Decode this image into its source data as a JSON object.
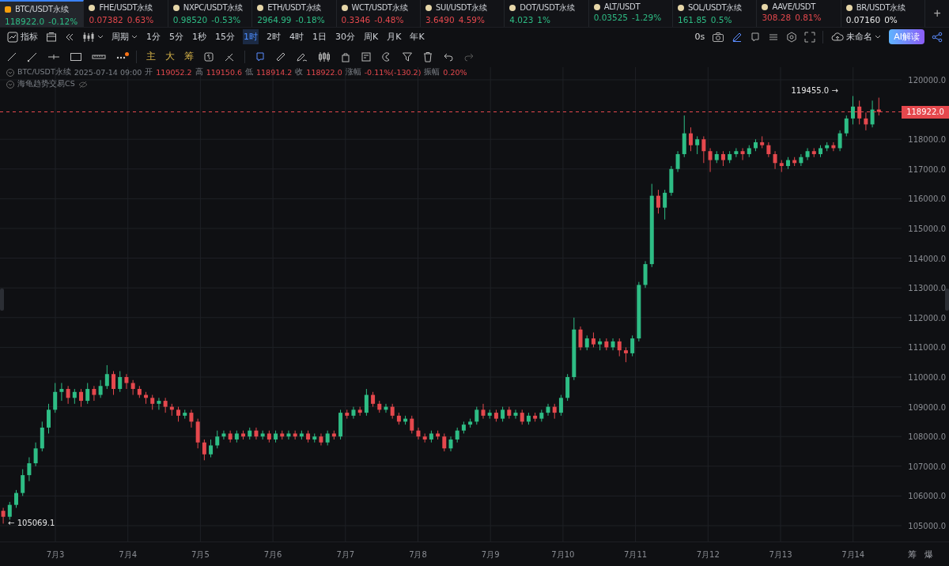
{
  "tickers": [
    {
      "symbol": "BTC/USDT永续",
      "price": "118922.0",
      "change": "-0.12%",
      "color": "#2ebd85",
      "selected": true
    },
    {
      "symbol": "FHE/USDT永续",
      "price": "0.07382",
      "change": "0.63%",
      "color": "#e5484d",
      "selected": false
    },
    {
      "symbol": "NXPC/USDT永续",
      "price": "0.98520",
      "change": "-0.53%",
      "color": "#2ebd85",
      "selected": false
    },
    {
      "symbol": "ETH/USDT永续",
      "price": "2964.99",
      "change": "-0.18%",
      "color": "#2ebd85",
      "selected": false
    },
    {
      "symbol": "WCT/USDT永续",
      "price": "0.3346",
      "change": "-0.48%",
      "color": "#e5484d",
      "selected": false
    },
    {
      "symbol": "SUI/USDT永续",
      "price": "3.6490",
      "change": "4.59%",
      "color": "#e5484d",
      "selected": false
    },
    {
      "symbol": "DOT/USDT永续",
      "price": "4.023",
      "change": "1%",
      "color": "#2ebd85",
      "selected": false
    },
    {
      "symbol": "ALT/USDT",
      "price": "0.03525",
      "change": "-1.29%",
      "color": "#2ebd85",
      "selected": false
    },
    {
      "symbol": "SOL/USDT永续",
      "price": "161.85",
      "change": "0.5%",
      "color": "#2ebd85",
      "selected": false
    },
    {
      "symbol": "AAVE/USDT",
      "price": "308.28",
      "change": "0.81%",
      "color": "#e5484d",
      "selected": false
    },
    {
      "symbol": "BR/USDT永续",
      "price": "0.07160",
      "change": "0%",
      "color": "#e8e8e8",
      "selected": false
    }
  ],
  "add_tab": "+",
  "toolbar": {
    "indicators": "指标",
    "period": "周期",
    "intervals": [
      {
        "label": "1分",
        "selected": false
      },
      {
        "label": "5分",
        "selected": false
      },
      {
        "label": "1秒",
        "selected": false
      },
      {
        "label": "15分",
        "selected": false
      },
      {
        "label": "1时",
        "selected": true
      },
      {
        "label": "2时",
        "selected": false
      },
      {
        "label": "4时",
        "selected": false
      },
      {
        "label": "1日",
        "selected": false
      },
      {
        "label": "30分",
        "selected": false
      },
      {
        "label": "周K",
        "selected": false
      },
      {
        "label": "月K",
        "selected": false
      },
      {
        "label": "年K",
        "selected": false
      }
    ],
    "countdown": "0s",
    "layout_name": "未命名",
    "ai_button": "AI解读"
  },
  "draw_tools": {
    "text_tools": [
      "主",
      "大",
      "筹"
    ]
  },
  "info": {
    "symbol": "BTC/USDT永续",
    "time": "2025-07-14 09:00",
    "fields": [
      {
        "label": "开",
        "value": "119052.2"
      },
      {
        "label": "高",
        "value": "119150.6"
      },
      {
        "label": "低",
        "value": "118914.2"
      },
      {
        "label": "收",
        "value": "118922.0"
      },
      {
        "label": "涨幅",
        "value": "-0.11%(-130.2)"
      },
      {
        "label": "振幅",
        "value": "0.20%"
      }
    ],
    "indicator": "海龟趋势交易CS"
  },
  "chart": {
    "high_marker": "119455.0 →",
    "low_marker": "← 105069.1",
    "current_price": "118922.0",
    "x_labels": [
      "7月3",
      "7月4",
      "7月5",
      "7月6",
      "7月7",
      "7月8",
      "7月9",
      "7月10",
      "7月11",
      "7月12",
      "7月13",
      "7月14"
    ],
    "chart_data": {
      "type": "candlestick",
      "ylim": [
        104468,
        120425
      ],
      "grid": true,
      "ref_lines": [
        {
          "axis": "y",
          "value": 118922,
          "color": "#e5484d"
        }
      ],
      "yticks": [
        {
          "value": 120000,
          "label": "120000.0"
        },
        {
          "value": 118000,
          "label": "118000.0"
        },
        {
          "value": 117000,
          "label": "117000.0"
        },
        {
          "value": 116000,
          "label": "116000.0"
        },
        {
          "value": 115000,
          "label": "115000.0"
        },
        {
          "value": 114000,
          "label": "114000.0"
        },
        {
          "value": 113000,
          "label": "113000.0"
        },
        {
          "value": 112000,
          "label": "112000.0"
        },
        {
          "value": 111000,
          "label": "111000.0"
        },
        {
          "value": 110000,
          "label": "110000.0"
        },
        {
          "value": 109000,
          "label": "109000.0"
        },
        {
          "value": 108000,
          "label": "108000.0"
        },
        {
          "value": 107000,
          "label": "107000.0"
        },
        {
          "value": 106000,
          "label": "106000.0"
        },
        {
          "value": 105000,
          "label": "105000.0"
        }
      ],
      "ohlc": [
        [
          105500,
          105600,
          105069,
          105300
        ],
        [
          105300,
          105800,
          105200,
          105700
        ],
        [
          105700,
          106200,
          105600,
          106100
        ],
        [
          106100,
          106900,
          106000,
          106700
        ],
        [
          106700,
          107300,
          106500,
          107100
        ],
        [
          107100,
          107800,
          107000,
          107600
        ],
        [
          107600,
          108500,
          107500,
          108300
        ],
        [
          108300,
          109100,
          108100,
          108900
        ],
        [
          108900,
          109800,
          108800,
          109500
        ],
        [
          109500,
          109800,
          109200,
          109600
        ],
        [
          109600,
          109700,
          109100,
          109300
        ],
        [
          109300,
          109600,
          109100,
          109500
        ],
        [
          109500,
          109600,
          109000,
          109200
        ],
        [
          109200,
          109800,
          109100,
          109600
        ],
        [
          109600,
          109700,
          109200,
          109400
        ],
        [
          109400,
          109900,
          109300,
          109700
        ],
        [
          109700,
          110400,
          109600,
          110100
        ],
        [
          110100,
          110200,
          109400,
          109600
        ],
        [
          109600,
          110200,
          109500,
          110000
        ],
        [
          110000,
          110100,
          109600,
          109800
        ],
        [
          109800,
          109900,
          109400,
          109600
        ],
        [
          109600,
          109700,
          109300,
          109400
        ],
        [
          109400,
          109500,
          109100,
          109300
        ],
        [
          109300,
          109400,
          108900,
          109100
        ],
        [
          109100,
          109300,
          108900,
          109200
        ],
        [
          109200,
          109300,
          108800,
          109000
        ],
        [
          109000,
          109100,
          108700,
          108900
        ],
        [
          108900,
          109000,
          108500,
          108700
        ],
        [
          108700,
          108900,
          108600,
          108800
        ],
        [
          108800,
          108900,
          108300,
          108500
        ],
        [
          108500,
          108600,
          107600,
          107800
        ],
        [
          107800,
          107900,
          107200,
          107400
        ],
        [
          107400,
          107900,
          107300,
          107700
        ],
        [
          107700,
          108200,
          107600,
          108000
        ],
        [
          108000,
          108200,
          107900,
          108100
        ],
        [
          108100,
          108200,
          107800,
          107900
        ],
        [
          107900,
          108200,
          107800,
          108100
        ],
        [
          108100,
          108200,
          107900,
          108000
        ],
        [
          108000,
          108300,
          107900,
          108200
        ],
        [
          108200,
          108300,
          107900,
          108000
        ],
        [
          108000,
          108200,
          107900,
          108100
        ],
        [
          108100,
          108200,
          107800,
          107900
        ],
        [
          107900,
          108200,
          107800,
          108100
        ],
        [
          108100,
          108200,
          107900,
          108000
        ],
        [
          108000,
          108200,
          107900,
          108100
        ],
        [
          108100,
          108200,
          107900,
          108000
        ],
        [
          108000,
          108200,
          107900,
          108100
        ],
        [
          108100,
          108200,
          107800,
          107900
        ],
        [
          107900,
          108100,
          107800,
          108000
        ],
        [
          108000,
          108100,
          107700,
          107800
        ],
        [
          107800,
          108200,
          107700,
          108100
        ],
        [
          108100,
          108200,
          107900,
          108000
        ],
        [
          108000,
          108900,
          107900,
          108800
        ],
        [
          108800,
          108900,
          108600,
          108700
        ],
        [
          108700,
          109000,
          108600,
          108900
        ],
        [
          108900,
          109000,
          108700,
          108800
        ],
        [
          108800,
          109600,
          108700,
          109400
        ],
        [
          109400,
          109500,
          109000,
          109100
        ],
        [
          109100,
          109200,
          108800,
          108900
        ],
        [
          108900,
          109100,
          108800,
          109000
        ],
        [
          109000,
          109100,
          108600,
          108700
        ],
        [
          108700,
          108800,
          108400,
          108500
        ],
        [
          108500,
          108700,
          108400,
          108600
        ],
        [
          108600,
          108700,
          108100,
          108200
        ],
        [
          108200,
          108300,
          107900,
          108000
        ],
        [
          108000,
          108100,
          107800,
          107900
        ],
        [
          107900,
          108200,
          107800,
          108100
        ],
        [
          108100,
          108200,
          107900,
          108000
        ],
        [
          108000,
          108100,
          107500,
          107600
        ],
        [
          107600,
          108000,
          107500,
          107900
        ],
        [
          107900,
          108300,
          107800,
          108200
        ],
        [
          108200,
          108500,
          108100,
          108400
        ],
        [
          108400,
          108600,
          108300,
          108500
        ],
        [
          108500,
          109000,
          108400,
          108900
        ],
        [
          108900,
          109100,
          108600,
          108700
        ],
        [
          108700,
          108900,
          108600,
          108800
        ],
        [
          108800,
          108900,
          108500,
          108600
        ],
        [
          108600,
          109000,
          108500,
          108900
        ],
        [
          108900,
          109000,
          108600,
          108700
        ],
        [
          108700,
          108900,
          108600,
          108800
        ],
        [
          108800,
          108900,
          108400,
          108500
        ],
        [
          108500,
          108800,
          108400,
          108700
        ],
        [
          108700,
          108800,
          108500,
          108600
        ],
        [
          108600,
          108900,
          108500,
          108800
        ],
        [
          108800,
          109100,
          108700,
          109000
        ],
        [
          109000,
          109100,
          108600,
          108800
        ],
        [
          108800,
          109400,
          108700,
          109300
        ],
        [
          109300,
          110100,
          109200,
          110000
        ],
        [
          110000,
          112000,
          109900,
          111600
        ],
        [
          111600,
          111700,
          110900,
          111000
        ],
        [
          111000,
          111400,
          110900,
          111300
        ],
        [
          111300,
          111500,
          111000,
          111100
        ],
        [
          111100,
          111300,
          110900,
          111200
        ],
        [
          111200,
          111300,
          110900,
          111000
        ],
        [
          111000,
          111300,
          110900,
          111200
        ],
        [
          111200,
          111300,
          110700,
          110900
        ],
        [
          110900,
          111000,
          110500,
          110800
        ],
        [
          110800,
          111400,
          110700,
          111300
        ],
        [
          111300,
          113200,
          111200,
          113100
        ],
        [
          113100,
          113900,
          113000,
          113800
        ],
        [
          113800,
          116500,
          113700,
          116100
        ],
        [
          116100,
          116300,
          115500,
          115700
        ],
        [
          115700,
          116300,
          115300,
          116200
        ],
        [
          116200,
          117100,
          116100,
          117000
        ],
        [
          117000,
          117600,
          116900,
          117500
        ],
        [
          117500,
          118800,
          117400,
          118200
        ],
        [
          118200,
          118400,
          117600,
          117800
        ],
        [
          117800,
          118100,
          117500,
          118000
        ],
        [
          118000,
          118100,
          117200,
          117600
        ],
        [
          117600,
          117700,
          116900,
          117300
        ],
        [
          117300,
          117600,
          117200,
          117500
        ],
        [
          117500,
          117600,
          117100,
          117300
        ],
        [
          117300,
          117600,
          117200,
          117500
        ],
        [
          117500,
          117700,
          117400,
          117600
        ],
        [
          117600,
          117700,
          117300,
          117500
        ],
        [
          117500,
          117800,
          117400,
          117700
        ],
        [
          117700,
          118000,
          117600,
          117900
        ],
        [
          117900,
          118100,
          117700,
          117800
        ],
        [
          117800,
          117900,
          117400,
          117500
        ],
        [
          117500,
          117600,
          117000,
          117200
        ],
        [
          117200,
          117300,
          116900,
          117100
        ],
        [
          117100,
          117400,
          117000,
          117300
        ],
        [
          117300,
          117400,
          117100,
          117200
        ],
        [
          117200,
          117500,
          117100,
          117400
        ],
        [
          117400,
          117700,
          117300,
          117600
        ],
        [
          117600,
          117700,
          117400,
          117500
        ],
        [
          117500,
          117800,
          117400,
          117700
        ],
        [
          117700,
          117900,
          117600,
          117800
        ],
        [
          117800,
          117900,
          117600,
          117700
        ],
        [
          117700,
          118300,
          117600,
          118200
        ],
        [
          118200,
          118800,
          118100,
          118700
        ],
        [
          118700,
          119455,
          118500,
          119100
        ],
        [
          119100,
          119300,
          118500,
          118700
        ],
        [
          118700,
          118900,
          118300,
          118500
        ],
        [
          118500,
          119300,
          118400,
          119000
        ],
        [
          119000,
          119400,
          118800,
          118922
        ]
      ]
    }
  },
  "corner_buttons": [
    "筹",
    "爆"
  ]
}
